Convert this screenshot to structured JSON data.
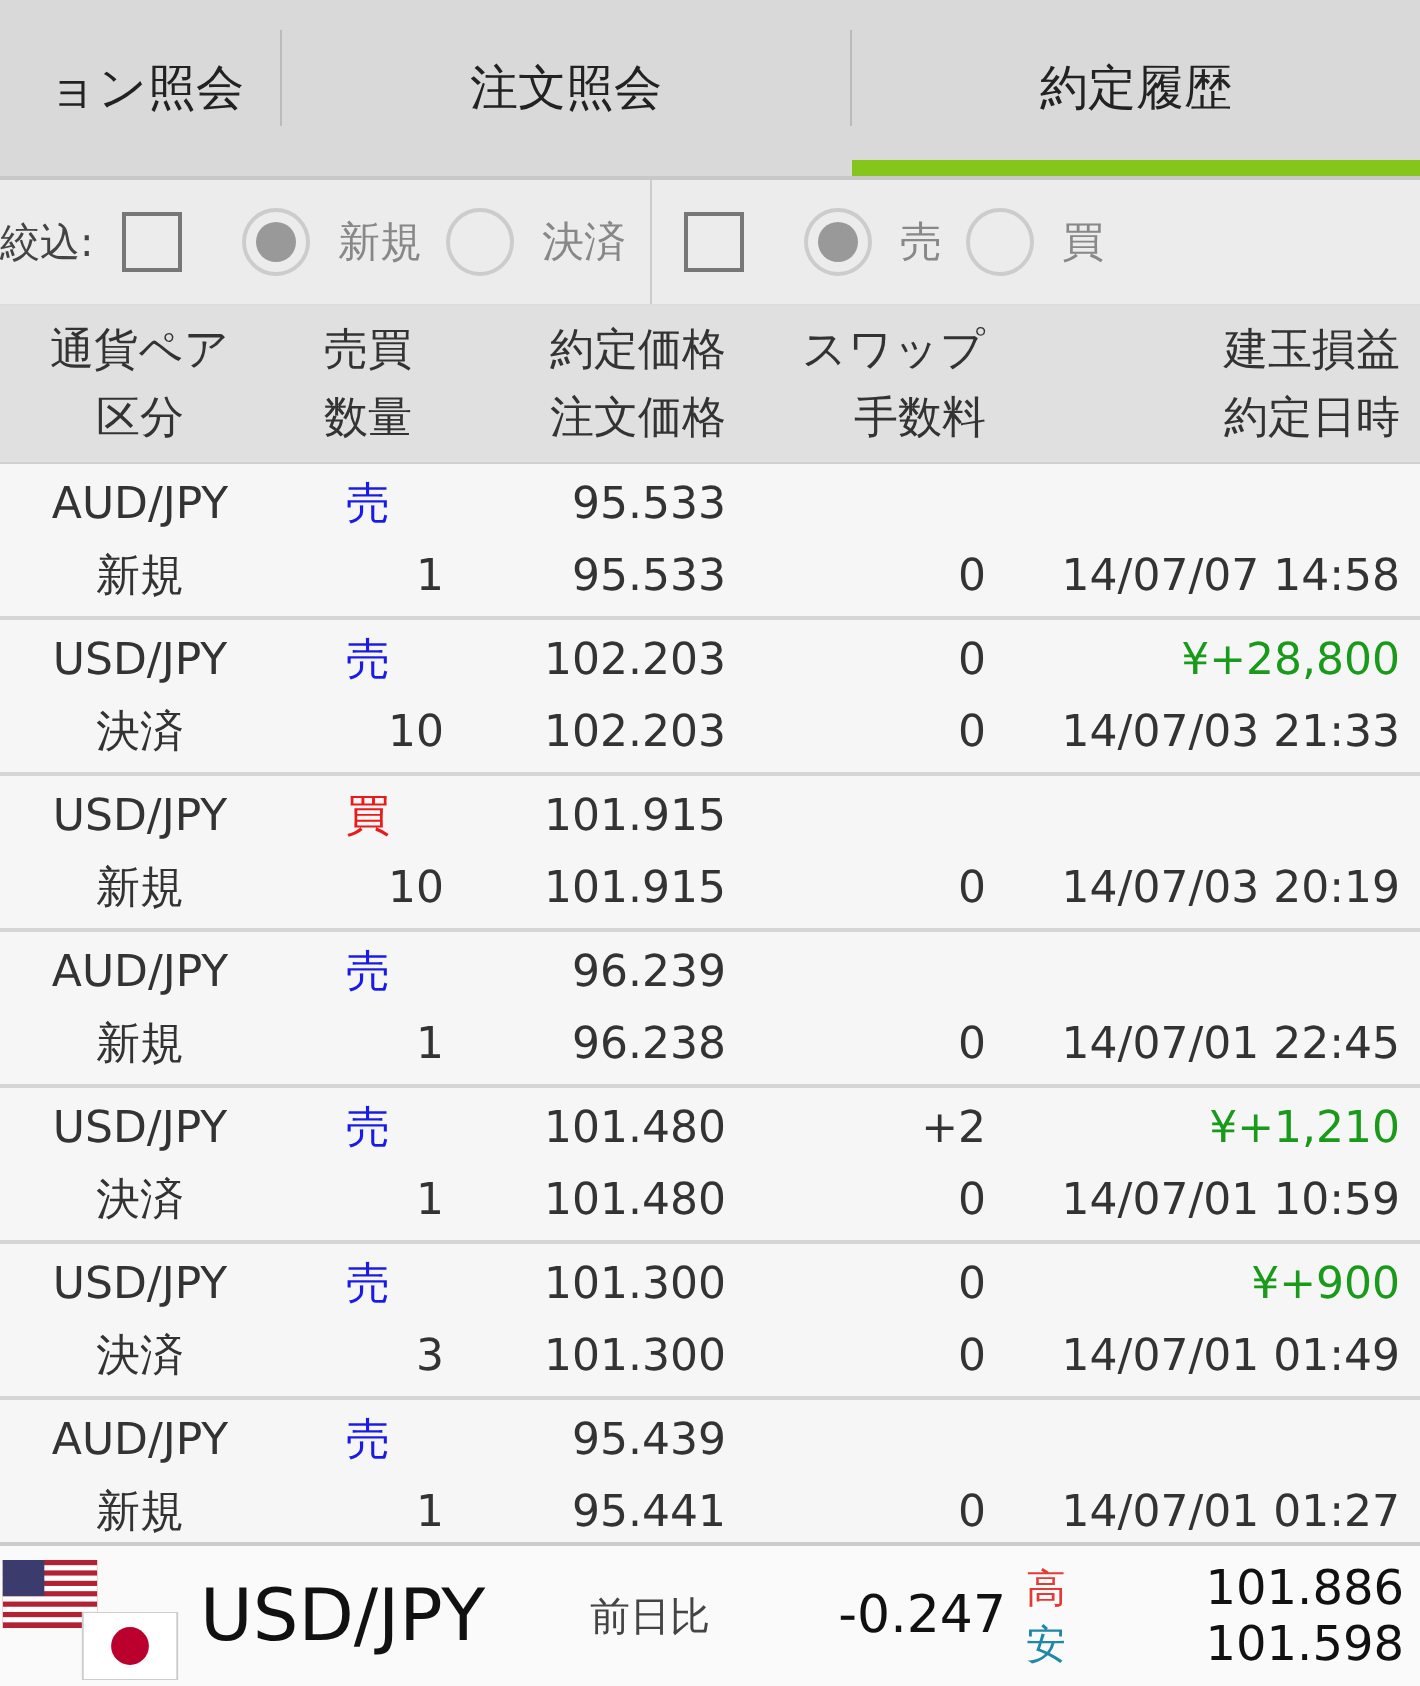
{
  "tabs": [
    {
      "label": "ョン照会",
      "selected": false
    },
    {
      "label": "注文照会",
      "selected": false
    },
    {
      "label": "約定履歴",
      "selected": true
    }
  ],
  "filter": {
    "label": "絞込:",
    "groups": [
      {
        "checked": false,
        "options": [
          {
            "label": "新規",
            "selected": true
          },
          {
            "label": "決済",
            "selected": false
          }
        ]
      },
      {
        "checked": false,
        "options": [
          {
            "label": "売",
            "selected": true
          },
          {
            "label": "買",
            "selected": false
          }
        ]
      }
    ]
  },
  "table": {
    "columns": [
      [
        "通貨ペア",
        "区分"
      ],
      [
        "売買",
        "数量"
      ],
      [
        "約定価格",
        "注文価格"
      ],
      [
        "スワップ",
        "手数料"
      ],
      [
        "建玉損益",
        "約定日時"
      ]
    ],
    "rows": [
      {
        "pair": "AUD/JPY",
        "type": "新規",
        "side": "売",
        "color": "#1a1ae8",
        "qty": "1",
        "price": "95.533",
        "order_price": "95.533",
        "swap": "",
        "fee": "0",
        "pnl": "",
        "date": "14/07/07 14:58"
      },
      {
        "pair": "USD/JPY",
        "type": "決済",
        "side": "売",
        "color": "#1a1ae8",
        "qty": "10",
        "price": "102.203",
        "order_price": "102.203",
        "swap": "0",
        "fee": "0",
        "pnl": "¥+28,800",
        "date": "14/07/03 21:33"
      },
      {
        "pair": "USD/JPY",
        "type": "新規",
        "side": "買",
        "color": "#e81a1a",
        "qty": "10",
        "price": "101.915",
        "order_price": "101.915",
        "swap": "",
        "fee": "0",
        "pnl": "",
        "date": "14/07/03 20:19"
      },
      {
        "pair": "AUD/JPY",
        "type": "新規",
        "side": "売",
        "color": "#1a1ae8",
        "qty": "1",
        "price": "96.239",
        "order_price": "96.238",
        "swap": "",
        "fee": "0",
        "pnl": "",
        "date": "14/07/01 22:45"
      },
      {
        "pair": "USD/JPY",
        "type": "決済",
        "side": "売",
        "color": "#1a1ae8",
        "qty": "1",
        "price": "101.480",
        "order_price": "101.480",
        "swap": "+2",
        "fee": "0",
        "pnl": "¥+1,210",
        "date": "14/07/01 10:59"
      },
      {
        "pair": "USD/JPY",
        "type": "決済",
        "side": "売",
        "color": "#1a1ae8",
        "qty": "3",
        "price": "101.300",
        "order_price": "101.300",
        "swap": "0",
        "fee": "0",
        "pnl": "¥+900",
        "date": "14/07/01 01:49"
      },
      {
        "pair": "AUD/JPY",
        "type": "新規",
        "side": "売",
        "color": "#1a1ae8",
        "qty": "1",
        "price": "95.439",
        "order_price": "95.441",
        "swap": "",
        "fee": "0",
        "pnl": "",
        "date": "14/07/01 01:27"
      }
    ]
  },
  "ticker": {
    "pair": "USD/JPY",
    "change_label": "前日比",
    "change": "-0.247",
    "high_label": "高",
    "high": "101.886",
    "low_label": "安",
    "low": "101.598"
  }
}
